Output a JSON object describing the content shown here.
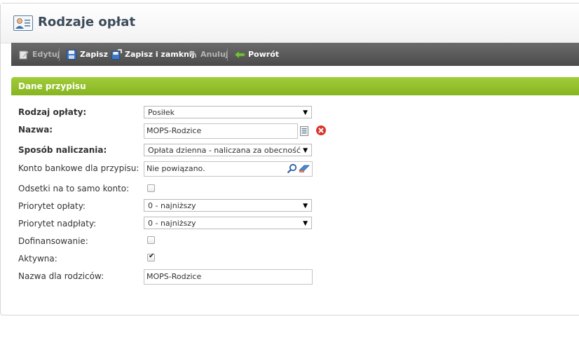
{
  "page": {
    "title": "Rodzaje opłat"
  },
  "toolbar": {
    "edit_label": "Edytuj",
    "save_label": "Zapisz",
    "save_close_label": "Zapisz i zamknij",
    "cancel_label": "Anuluj",
    "back_label": "Powrót"
  },
  "section": {
    "title": "Dane przypisu"
  },
  "form": {
    "fee_type": {
      "label": "Rodzaj opłaty:",
      "value": "Posiłek"
    },
    "name": {
      "label": "Nazwa:",
      "value": "MOPS-Rodzice"
    },
    "charge_method": {
      "label": "Sposób naliczania:",
      "value": "Opłata dzienna - naliczana za obecność"
    },
    "bank_account": {
      "label": "Konto bankowe dla przypisu:",
      "value": "Nie powiązano."
    },
    "interest_same_account": {
      "label": "Odsetki na to samo konto:",
      "checked": false
    },
    "fee_priority": {
      "label": "Priorytet opłaty:",
      "value": "0 - najniższy"
    },
    "overpayment_priority": {
      "label": "Priorytet nadpłaty:",
      "value": "0 - najniższy"
    },
    "cofinancing": {
      "label": "Dofinansowanie:",
      "checked": false
    },
    "active": {
      "label": "Aktywna:",
      "checked": true,
      "checkmark": "✔"
    },
    "parent_name": {
      "label": "Nazwa dla rodziców:",
      "value": "MOPS-Rodzice"
    }
  },
  "colors": {
    "toolbar_bg": "#5a5a5a",
    "section_green": "#93c02a",
    "title_text": "#3c4b5a",
    "error_red": "#d9342b"
  },
  "icons": [
    "user-card-icon",
    "edit-icon",
    "save-icon",
    "save-close-icon",
    "undo-icon",
    "back-arrow-icon",
    "list-icon",
    "clear-icon",
    "search-icon",
    "eraser-icon"
  ]
}
